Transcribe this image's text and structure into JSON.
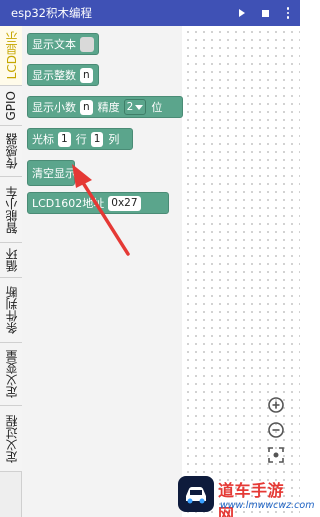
{
  "app": {
    "title": "esp32积木编程"
  },
  "toolbar": {
    "run_icon": "play-icon",
    "stop_icon": "stop-icon",
    "menu_icon": "more-vert-icon"
  },
  "categories": [
    {
      "label": "LCD显示",
      "active": true
    },
    {
      "label": "GPIO"
    },
    {
      "label": "传感器"
    },
    {
      "label": "智能小车"
    },
    {
      "label": "循环"
    },
    {
      "label": "条件判断"
    },
    {
      "label": "定义变量"
    },
    {
      "label": "定义过程"
    }
  ],
  "blocks": {
    "show_text": {
      "label": "显示文本"
    },
    "show_int": {
      "label": "显示整数",
      "value": "n"
    },
    "show_float": {
      "label": "显示小数",
      "value": "n",
      "precision_label": "精度",
      "precision": "2",
      "unit": "位"
    },
    "cursor": {
      "label": "光标",
      "row": "1",
      "row_label": "行",
      "col": "1",
      "col_label": "列"
    },
    "clear": {
      "label": "清空显示"
    },
    "lcd_addr": {
      "label": "LCD1602地址",
      "value": "0x27"
    }
  },
  "zoom": {
    "in_icon": "zoom-in-icon",
    "out_icon": "zoom-out-icon",
    "center_icon": "recenter-icon"
  },
  "watermark": {
    "title": "道车手游网",
    "url": "www.lmwwcwz.com"
  },
  "colors": {
    "appbar": "#3f51b5",
    "block": "#5ba58c",
    "arrow": "#e53935",
    "active_tab": "#c6a700"
  }
}
